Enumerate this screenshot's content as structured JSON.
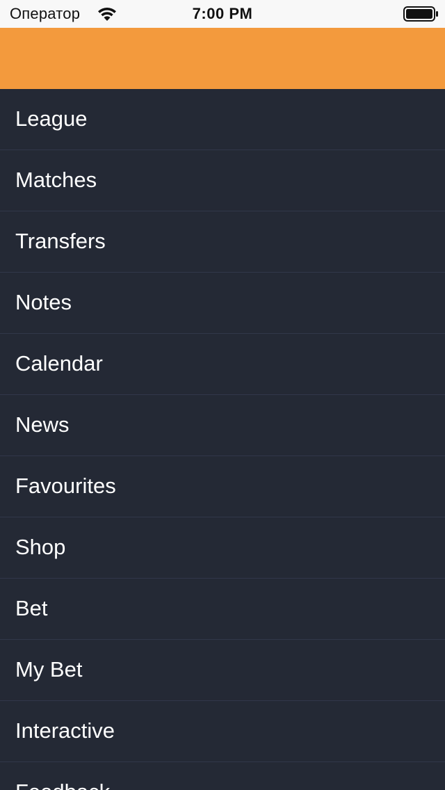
{
  "status_bar": {
    "carrier": "Оператор",
    "time": "7:00 PM",
    "wifi_icon": "wifi-icon",
    "battery_icon": "battery-icon"
  },
  "header": {
    "color": "#f39a3d"
  },
  "menu": {
    "items": [
      {
        "label": "League"
      },
      {
        "label": "Matches"
      },
      {
        "label": "Transfers"
      },
      {
        "label": "Notes"
      },
      {
        "label": "Calendar"
      },
      {
        "label": "News"
      },
      {
        "label": "Favourites"
      },
      {
        "label": "Shop"
      },
      {
        "label": "Bet"
      },
      {
        "label": "My Bet"
      },
      {
        "label": "Interactive"
      },
      {
        "label": "Feedback"
      }
    ]
  },
  "colors": {
    "background": "#242935",
    "separator": "#31374a",
    "text": "#ffffff",
    "accent": "#f39a3d"
  }
}
